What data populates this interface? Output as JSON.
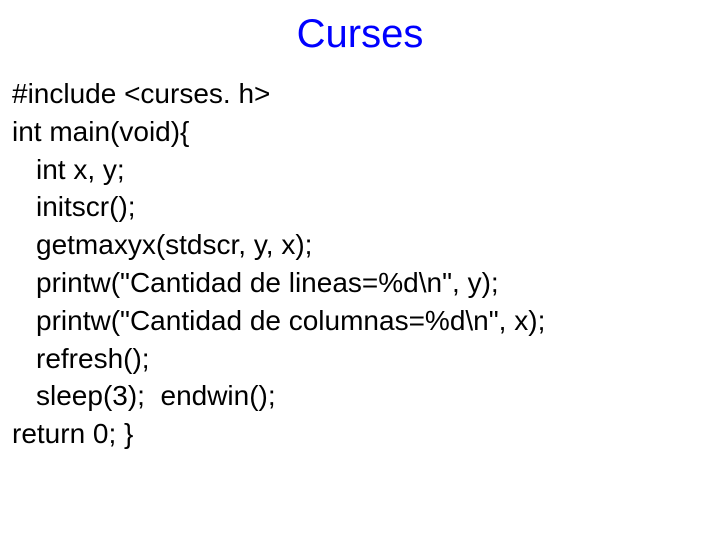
{
  "title": "Curses",
  "code": {
    "l1": "#include <curses. h>",
    "l2": "int main(void){",
    "l3": "int x, y;",
    "l4": "initscr();",
    "l5": "getmaxyx(stdscr, y, x);",
    "l6": "printw(\"Cantidad de lineas=%d\\n\", y);",
    "l7": "printw(\"Cantidad de columnas=%d\\n\", x);",
    "l8": "refresh();",
    "l9": "sleep(3);  endwin();",
    "l10": "return 0; }"
  }
}
